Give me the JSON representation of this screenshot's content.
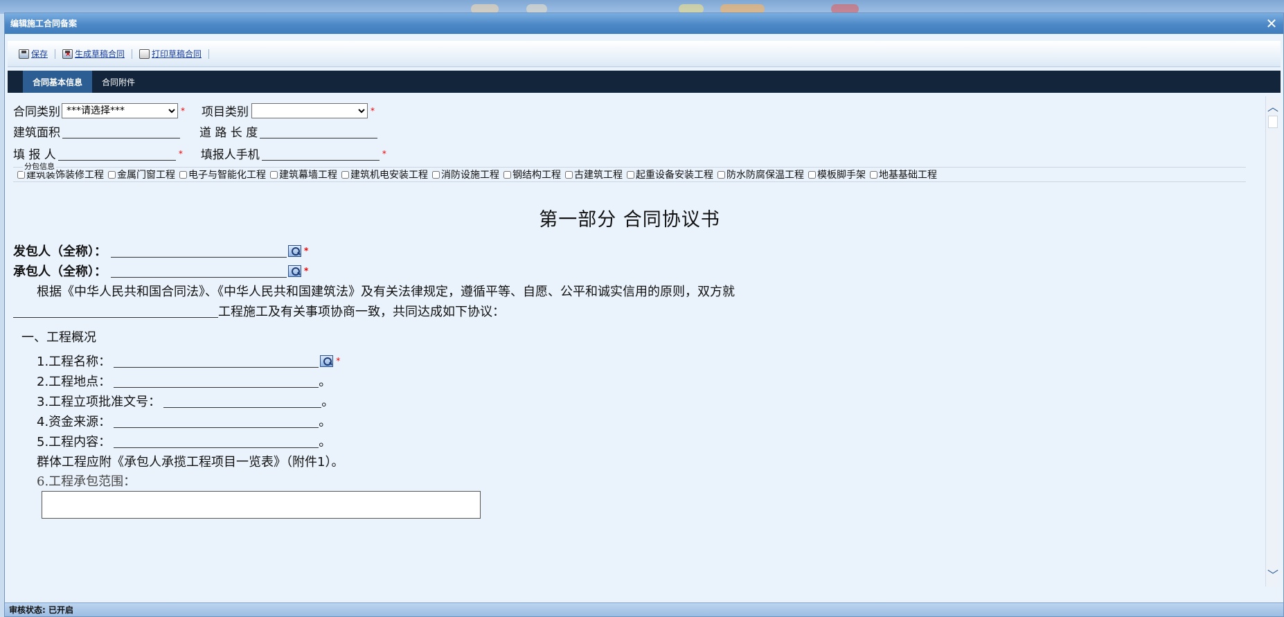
{
  "window": {
    "title": "编辑施工合同备案",
    "close_glyph": "✕"
  },
  "toolbar": {
    "save_label": "保存",
    "generate_label": "生成草稿合同",
    "print_label": "打印草稿合同"
  },
  "tabs": [
    {
      "label": "合同基本信息",
      "active": true
    },
    {
      "label": "合同附件",
      "active": false
    }
  ],
  "form": {
    "contract_type_label": "合同类别",
    "contract_type_value": "***请选择***",
    "project_type_label": "项目类别",
    "project_type_value": "",
    "building_area_label": "建筑面积",
    "road_length_label": "道 路 长 度",
    "reporter_label": "填 报 人",
    "reporter_phone_label": "填报人手机",
    "required_mark": "*"
  },
  "subcontract": {
    "legend": "分包信息",
    "items": [
      "建筑装饰装修工程",
      "金属门窗工程",
      "电子与智能化工程",
      "建筑幕墙工程",
      "建筑机电安装工程",
      "消防设施工程",
      "钢结构工程",
      "古建筑工程",
      "起重设备安装工程",
      "防水防腐保温工程",
      "模板脚手架",
      "地基基础工程"
    ]
  },
  "doc": {
    "title": "第一部分  合同协议书",
    "employer_label": "发包人（全称）：",
    "contractor_label": "承包人（全称）：",
    "intro_line1": "根据《中华人民共和国合同法》、《中华人民共和国建筑法》及有关法律规定，遵循平等、自愿、公平和诚实信用的原则，双方就",
    "intro_line2": "工程施工及有关事项协商一致，共同达成如下协议：",
    "section1_title": "一、工程概况",
    "item1": "1.工程名称：",
    "item2": "2.工程地点：",
    "item3": "3.工程立项批准文号：",
    "item4": "4.资金来源：",
    "item5": "5.工程内容：",
    "period": "。",
    "group_note": "群体工程应附《承包人承揽工程项目一览表》（附件1）。",
    "item6": "6.工程承包范围："
  },
  "status": {
    "text": "审核状态: 已开启"
  },
  "colors": {
    "tabbar": "#12253b",
    "active_tab": "#2c5e93",
    "required": "#e00000",
    "link": "#1a3f9c"
  }
}
